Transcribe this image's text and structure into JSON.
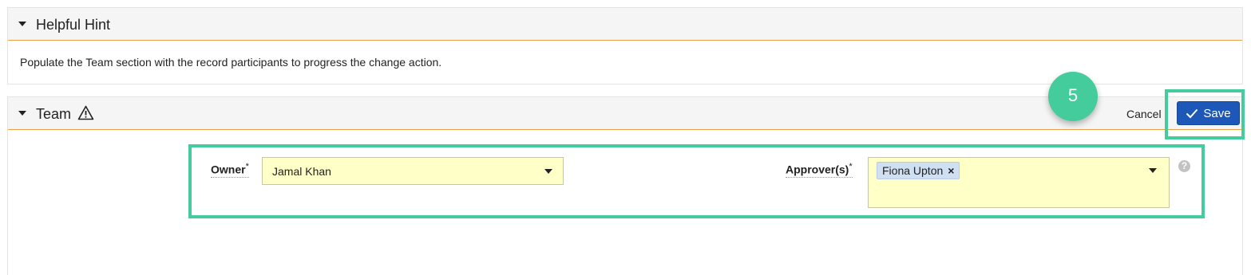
{
  "hint_panel": {
    "title": "Helpful Hint",
    "message": "Populate the Team section with the record participants to progress the change action."
  },
  "team_panel": {
    "title": "Team",
    "warning_icon": "warning-triangle-icon"
  },
  "toolbar": {
    "step_number": "5",
    "cancel_label": "Cancel",
    "save_label": "Save"
  },
  "fields": {
    "owner": {
      "label": "Owner",
      "required_mark": "*",
      "value": "Jamal Khan"
    },
    "approvers": {
      "label": "Approver(s)",
      "required_mark": "*",
      "tags": [
        "Fiona Upton"
      ],
      "remove_glyph": "×"
    },
    "help_glyph": "?"
  },
  "colors": {
    "highlight": "#45cc9c",
    "save_button": "#1d58b8",
    "header_underline": "#e8a24a",
    "field_background": "#ffffc8"
  }
}
